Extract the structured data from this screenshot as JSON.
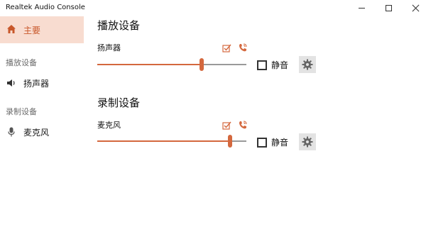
{
  "window": {
    "title": "Realtek Audio Console",
    "controls": {
      "minimize": "minimize",
      "maximize": "maximize",
      "close": "close"
    }
  },
  "sidebar": {
    "home_label": "主要",
    "playback_section": "播放设备",
    "recording_section": "录制设备",
    "speaker_label": "扬声器",
    "mic_label": "麦克风"
  },
  "main": {
    "playback_title": "播放设备",
    "recording_title": "录制设备",
    "speaker": {
      "name": "扬声器",
      "volume_fraction": 0.7,
      "mute_label": "静音",
      "muted": false
    },
    "microphone": {
      "name": "麦克风",
      "volume_fraction": 0.89,
      "mute_label": "静音",
      "muted": false
    }
  },
  "colors": {
    "accent": "#d4683e",
    "accent_bg": "#f8dcd0",
    "accent_text": "#c8572a"
  },
  "icons": {
    "home": "home-icon",
    "speaker": "speaker-icon",
    "mic": "microphone-icon",
    "default_device": "default-device-check-icon",
    "default_comm": "default-communication-phone-icon",
    "settings": "gear-icon"
  }
}
